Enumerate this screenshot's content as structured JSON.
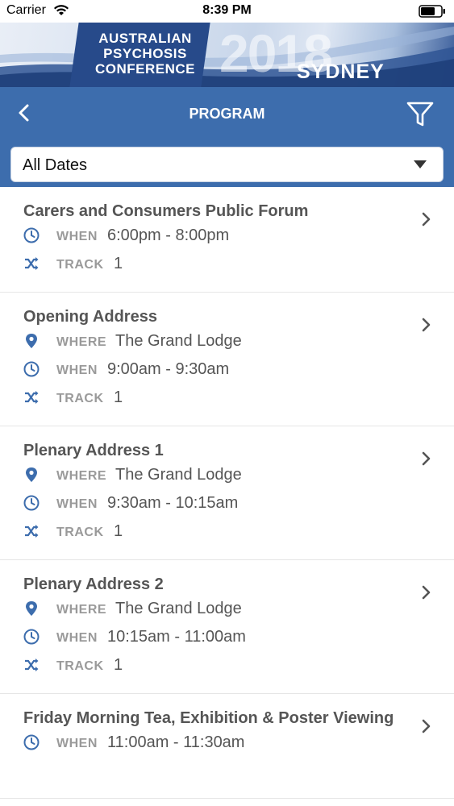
{
  "status_bar": {
    "carrier": "Carrier",
    "time": "8:39 PM"
  },
  "banner": {
    "line1": "AUSTRALIAN",
    "line2": "PSYCHOSIS",
    "line3": "CONFERENCE",
    "year": "2018",
    "city": "SYDNEY"
  },
  "nav": {
    "title": "PROGRAM"
  },
  "date_filter": {
    "selected": "All Dates"
  },
  "labels": {
    "where": "WHERE",
    "when": "WHEN",
    "track": "TRACK"
  },
  "sessions": [
    {
      "title": "Carers and Consumers Public Forum",
      "when": "6:00pm - 8:00pm",
      "track": "1"
    },
    {
      "title": "Opening Address",
      "where": "The Grand Lodge",
      "when": "9:00am - 9:30am",
      "track": "1"
    },
    {
      "title": "Plenary Address 1",
      "where": "The Grand Lodge",
      "when": "9:30am - 10:15am",
      "track": "1"
    },
    {
      "title": "Plenary Address 2",
      "where": "The Grand Lodge",
      "when": "10:15am - 11:00am",
      "track": "1"
    },
    {
      "title": "Friday Morning Tea, Exhibition & Poster Viewing",
      "when": "11:00am - 11:30am"
    }
  ],
  "colors": {
    "accent": "#3d6dad",
    "icon": "#3d6dad",
    "label": "#9a9a9a"
  }
}
